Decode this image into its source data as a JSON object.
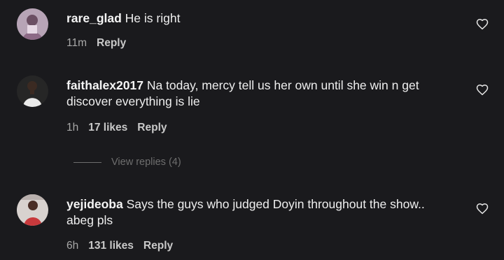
{
  "comments": [
    {
      "username": "rare_glad",
      "text": "He is right",
      "time": "11m",
      "likes": "",
      "reply_label": "Reply"
    },
    {
      "username": "faithalex2017",
      "text": "Na today, mercy tell us her own until she win n get discover everything is lie",
      "time": "1h",
      "likes": "17 likes",
      "reply_label": "Reply"
    },
    {
      "username": "yejideoba",
      "text": "Says the guys who judged Doyin throughout the show.. abeg pls",
      "time": "6h",
      "likes": "131 likes",
      "reply_label": "Reply"
    }
  ],
  "view_replies": "View replies (4)",
  "icons": {
    "like": "heart-outline-icon"
  },
  "colors": {
    "background": "#1a1a1d",
    "text": "#efefef",
    "muted": "#a8a8a8"
  }
}
